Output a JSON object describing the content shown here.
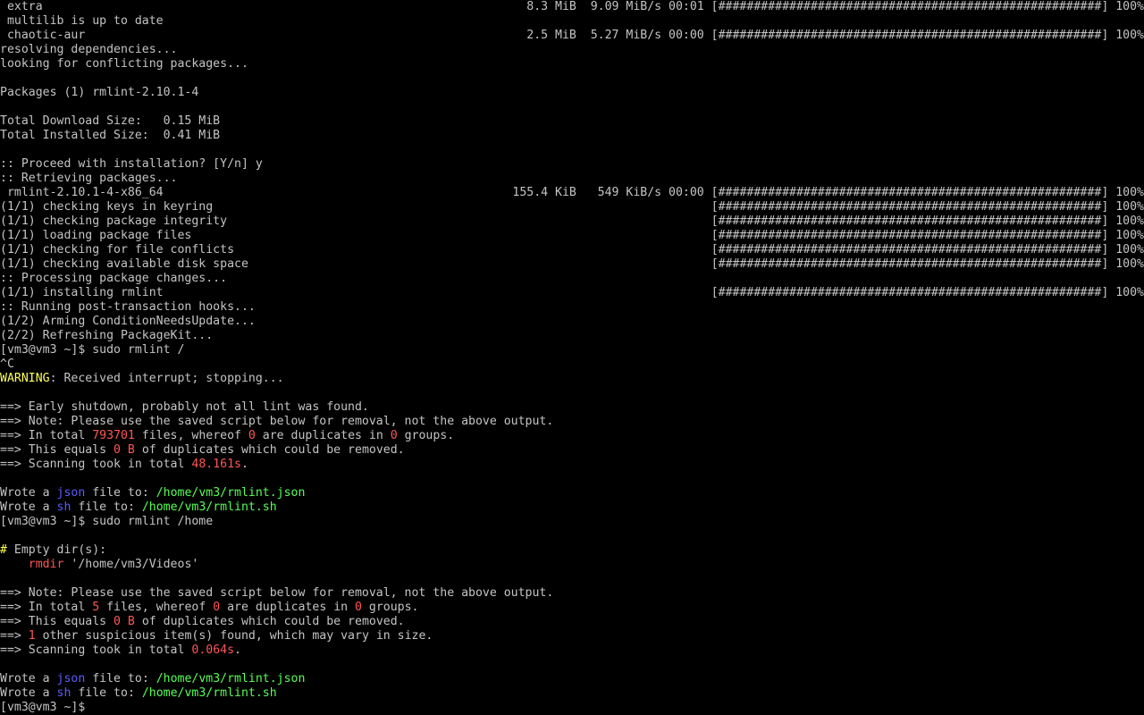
{
  "colors": {
    "background": "#000000",
    "default": "#c4c4c4",
    "warning": "#ffff55",
    "number": "#ff5555",
    "format": "#5c5cff",
    "path": "#55ff55",
    "comment": "#ffff55"
  },
  "terminal": {
    "lines": [
      {
        "kind": "sync-db",
        "segments": [
          {
            "text": " extra",
            "color": "default"
          }
        ],
        "right": "8.3 MiB  9.09 MiB/s 00:01 [######################################################] 100%"
      },
      {
        "kind": "output",
        "segments": [
          {
            "text": " multilib is up to date",
            "color": "default"
          }
        ]
      },
      {
        "kind": "sync-db",
        "segments": [
          {
            "text": " chaotic-aur",
            "color": "default"
          }
        ],
        "right": "2.5 MiB  5.27 MiB/s 00:00 [######################################################] 100%"
      },
      {
        "kind": "output",
        "segments": [
          {
            "text": "resolving dependencies...",
            "color": "default"
          }
        ]
      },
      {
        "kind": "output",
        "segments": [
          {
            "text": "looking for conflicting packages...",
            "color": "default"
          }
        ]
      },
      {
        "kind": "blank",
        "segments": []
      },
      {
        "kind": "output",
        "segments": [
          {
            "text": "Packages (1) rmlint-2.10.1-4",
            "color": "default"
          }
        ]
      },
      {
        "kind": "blank",
        "segments": []
      },
      {
        "kind": "output",
        "segments": [
          {
            "text": "Total Download Size:   0.15 MiB",
            "color": "default"
          }
        ]
      },
      {
        "kind": "output",
        "segments": [
          {
            "text": "Total Installed Size:  0.41 MiB",
            "color": "default"
          }
        ]
      },
      {
        "kind": "blank",
        "segments": []
      },
      {
        "kind": "output",
        "segments": [
          {
            "text": ":: Proceed with installation? [Y/n] y",
            "color": "default"
          }
        ]
      },
      {
        "kind": "output",
        "segments": [
          {
            "text": ":: Retrieving packages...",
            "color": "default"
          }
        ]
      },
      {
        "kind": "download",
        "segments": [
          {
            "text": " rmlint-2.10.1-4-x86_64",
            "color": "default"
          }
        ],
        "right": "155.4 KiB   549 KiB/s 00:00 [######################################################] 100%"
      },
      {
        "kind": "progress",
        "segments": [
          {
            "text": "(1/1) checking keys in keyring",
            "color": "default"
          }
        ],
        "right": "[######################################################] 100%"
      },
      {
        "kind": "progress",
        "segments": [
          {
            "text": "(1/1) checking package integrity",
            "color": "default"
          }
        ],
        "right": "[######################################################] 100%"
      },
      {
        "kind": "progress",
        "segments": [
          {
            "text": "(1/1) loading package files",
            "color": "default"
          }
        ],
        "right": "[######################################################] 100%"
      },
      {
        "kind": "progress",
        "segments": [
          {
            "text": "(1/1) checking for file conflicts",
            "color": "default"
          }
        ],
        "right": "[######################################################] 100%"
      },
      {
        "kind": "progress",
        "segments": [
          {
            "text": "(1/1) checking available disk space",
            "color": "default"
          }
        ],
        "right": "[######################################################] 100%"
      },
      {
        "kind": "output",
        "segments": [
          {
            "text": ":: Processing package changes...",
            "color": "default"
          }
        ]
      },
      {
        "kind": "progress",
        "segments": [
          {
            "text": "(1/1) installing rmlint",
            "color": "default"
          }
        ],
        "right": "[######################################################] 100%"
      },
      {
        "kind": "output",
        "segments": [
          {
            "text": ":: Running post-transaction hooks...",
            "color": "default"
          }
        ]
      },
      {
        "kind": "output",
        "segments": [
          {
            "text": "(1/2) Arming ConditionNeedsUpdate...",
            "color": "default"
          }
        ]
      },
      {
        "kind": "output",
        "segments": [
          {
            "text": "(2/2) Refreshing PackageKit...",
            "color": "default"
          }
        ]
      },
      {
        "kind": "prompt",
        "segments": [
          {
            "text": "[vm3@vm3 ~]$ sudo rmlint /",
            "color": "default"
          }
        ]
      },
      {
        "kind": "output",
        "segments": [
          {
            "text": "^C",
            "color": "default"
          }
        ]
      },
      {
        "kind": "output",
        "segments": [
          {
            "text": "WARNING",
            "color": "warning"
          },
          {
            "text": ": Received interrupt; stopping...",
            "color": "default"
          }
        ]
      },
      {
        "kind": "blank",
        "segments": []
      },
      {
        "kind": "output",
        "segments": [
          {
            "text": "==> Early shutdown, probably not all lint was found.",
            "color": "default"
          }
        ]
      },
      {
        "kind": "output",
        "segments": [
          {
            "text": "==> Note: Please use the saved script below for removal, not the above output.",
            "color": "default"
          }
        ]
      },
      {
        "kind": "output",
        "segments": [
          {
            "text": "==> In total ",
            "color": "default"
          },
          {
            "text": "793701",
            "color": "number"
          },
          {
            "text": " files, whereof ",
            "color": "default"
          },
          {
            "text": "0",
            "color": "number"
          },
          {
            "text": " are duplicates in ",
            "color": "default"
          },
          {
            "text": "0",
            "color": "number"
          },
          {
            "text": " groups.",
            "color": "default"
          }
        ]
      },
      {
        "kind": "output",
        "segments": [
          {
            "text": "==> This equals ",
            "color": "default"
          },
          {
            "text": "0 B",
            "color": "number"
          },
          {
            "text": " of duplicates which could be removed.",
            "color": "default"
          }
        ]
      },
      {
        "kind": "output",
        "segments": [
          {
            "text": "==> Scanning took in total ",
            "color": "default"
          },
          {
            "text": "48.161s",
            "color": "number"
          },
          {
            "text": ".",
            "color": "default"
          }
        ]
      },
      {
        "kind": "blank",
        "segments": []
      },
      {
        "kind": "output",
        "segments": [
          {
            "text": "Wrote a ",
            "color": "default"
          },
          {
            "text": "json",
            "color": "format"
          },
          {
            "text": " file to: ",
            "color": "default"
          },
          {
            "text": "/home/vm3/rmlint.json",
            "color": "path"
          }
        ]
      },
      {
        "kind": "output",
        "segments": [
          {
            "text": "Wrote a ",
            "color": "default"
          },
          {
            "text": "sh",
            "color": "format"
          },
          {
            "text": " file to: ",
            "color": "default"
          },
          {
            "text": "/home/vm3/rmlint.sh",
            "color": "path"
          }
        ]
      },
      {
        "kind": "prompt",
        "segments": [
          {
            "text": "[vm3@vm3 ~]$ sudo rmlint /home",
            "color": "default"
          }
        ]
      },
      {
        "kind": "blank",
        "segments": []
      },
      {
        "kind": "output",
        "segments": [
          {
            "text": "#",
            "color": "comment"
          },
          {
            "text": " Empty dir(s):",
            "color": "default"
          }
        ]
      },
      {
        "kind": "output",
        "segments": [
          {
            "text": "    ",
            "color": "default"
          },
          {
            "text": "rmdir",
            "color": "number"
          },
          {
            "text": " '/home/vm3/Videos'",
            "color": "default"
          }
        ]
      },
      {
        "kind": "blank",
        "segments": []
      },
      {
        "kind": "output",
        "segments": [
          {
            "text": "==> Note: Please use the saved script below for removal, not the above output.",
            "color": "default"
          }
        ]
      },
      {
        "kind": "output",
        "segments": [
          {
            "text": "==> In total ",
            "color": "default"
          },
          {
            "text": "5",
            "color": "number"
          },
          {
            "text": " files, whereof ",
            "color": "default"
          },
          {
            "text": "0",
            "color": "number"
          },
          {
            "text": " are duplicates in ",
            "color": "default"
          },
          {
            "text": "0",
            "color": "number"
          },
          {
            "text": " groups.",
            "color": "default"
          }
        ]
      },
      {
        "kind": "output",
        "segments": [
          {
            "text": "==> This equals ",
            "color": "default"
          },
          {
            "text": "0 B",
            "color": "number"
          },
          {
            "text": " of duplicates which could be removed.",
            "color": "default"
          }
        ]
      },
      {
        "kind": "output",
        "segments": [
          {
            "text": "==> ",
            "color": "default"
          },
          {
            "text": "1",
            "color": "number"
          },
          {
            "text": " other suspicious item(s) found, which may vary in size.",
            "color": "default"
          }
        ]
      },
      {
        "kind": "output",
        "segments": [
          {
            "text": "==> Scanning took in total ",
            "color": "default"
          },
          {
            "text": "0.064s",
            "color": "number"
          },
          {
            "text": ".",
            "color": "default"
          }
        ]
      },
      {
        "kind": "blank",
        "segments": []
      },
      {
        "kind": "output",
        "segments": [
          {
            "text": "Wrote a ",
            "color": "default"
          },
          {
            "text": "json",
            "color": "format"
          },
          {
            "text": " file to: ",
            "color": "default"
          },
          {
            "text": "/home/vm3/rmlint.json",
            "color": "path"
          }
        ]
      },
      {
        "kind": "output",
        "segments": [
          {
            "text": "Wrote a ",
            "color": "default"
          },
          {
            "text": "sh",
            "color": "format"
          },
          {
            "text": " file to: ",
            "color": "default"
          },
          {
            "text": "/home/vm3/rmlint.sh",
            "color": "path"
          }
        ]
      },
      {
        "kind": "prompt-active",
        "segments": [
          {
            "text": "[vm3@vm3 ~]$",
            "color": "default"
          }
        ]
      }
    ]
  }
}
